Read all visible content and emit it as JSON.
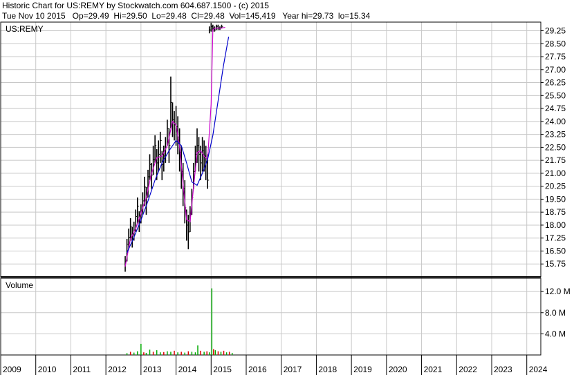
{
  "header": {
    "title": "Historic Chart for US:REMY by Stockwatch.com 604.687.1500 - (c) 2015",
    "info": "Tue Nov 10 2015   Op=29.49  Hi=29.50  Lo=29.48  Cl=29.48  Vol=145,419   Year hi=29.73  lo=15.34"
  },
  "colors": {
    "grid": "#c8c8c8",
    "price": "#000000",
    "ma_short": "#cc00cc",
    "ma_long": "#0000cc",
    "vol_up": "#00aa00",
    "vol_down": "#dd0000"
  },
  "chart_data": {
    "type": "line",
    "price_panel": {
      "label": "US:REMY",
      "ylim": [
        15.0,
        29.75
      ],
      "yticks": [
        "15.75",
        "16.50",
        "17.25",
        "18.00",
        "18.75",
        "19.50",
        "20.25",
        "21.00",
        "21.75",
        "22.50",
        "23.25",
        "24.00",
        "24.75",
        "25.50",
        "26.25",
        "27.00",
        "27.75",
        "28.50",
        "29.25"
      ],
      "xlim": [
        2009.0,
        2024.4
      ],
      "series": [
        {
          "role": "price",
          "x": [
            2012.55,
            2012.6,
            2012.65,
            2012.7,
            2012.75,
            2012.8,
            2012.85,
            2012.9,
            2012.95,
            2013.0,
            2013.05,
            2013.1,
            2013.15,
            2013.2,
            2013.25,
            2013.3,
            2013.35,
            2013.4,
            2013.45,
            2013.5,
            2013.55,
            2013.6,
            2013.65,
            2013.7,
            2013.75,
            2013.8,
            2013.85,
            2013.9,
            2013.95,
            2014.0,
            2014.05,
            2014.1,
            2014.15,
            2014.2,
            2014.25,
            2014.3,
            2014.35,
            2014.4,
            2014.45,
            2014.5,
            2014.55,
            2014.6,
            2014.65,
            2014.7,
            2014.75,
            2014.8,
            2014.85,
            2014.9,
            2014.95,
            2015.0,
            2015.05,
            2015.1,
            2015.15,
            2015.2,
            2015.25,
            2015.3,
            2015.35,
            2015.4,
            2015.45,
            2015.5,
            2015.55,
            2015.6,
            2015.65,
            2015.7,
            2015.75,
            2015.8,
            2015.85
          ],
          "high": [
            16.2,
            17.2,
            17.8,
            18.4,
            17.9,
            18.2,
            18.9,
            19.6,
            18.8,
            19.2,
            19.9,
            20.8,
            20.2,
            21.2,
            22.1,
            21.6,
            22.6,
            23.2,
            22.4,
            22.9,
            23.4,
            22.3,
            22.6,
            23.1,
            24.1,
            23.6,
            26.6,
            25.1,
            24.6,
            24.9,
            24.3,
            23.6,
            22.6,
            21.6,
            20.6,
            18.9,
            18.6,
            19.1,
            20.1,
            21.6,
            22.6,
            23.6,
            23.1,
            22.6,
            23.1,
            22.9,
            22.6,
            22.1,
            29.5,
            29.7,
            29.6,
            29.5,
            29.6,
            29.6,
            29.5,
            29.6
          ],
          "low": [
            15.3,
            15.9,
            16.6,
            17.1,
            16.7,
            17.1,
            17.6,
            18.1,
            17.6,
            18.1,
            18.6,
            19.1,
            18.6,
            19.6,
            20.6,
            20.1,
            20.9,
            21.6,
            20.6,
            21.1,
            21.6,
            20.6,
            21.1,
            21.6,
            22.6,
            21.6,
            23.6,
            23.1,
            22.9,
            22.6,
            22.1,
            21.1,
            20.1,
            19.1,
            18.1,
            17.1,
            16.6,
            17.6,
            18.6,
            20.1,
            21.1,
            21.6,
            21.1,
            20.6,
            21.1,
            21.1,
            20.6,
            20.1,
            29.1,
            29.2,
            29.2,
            29.2,
            29.3,
            29.3,
            29.3,
            29.4
          ],
          "close": [
            15.9,
            16.9,
            17.3,
            17.9,
            17.2,
            17.7,
            18.5,
            19.1,
            18.2,
            18.8,
            19.4,
            20.2,
            19.6,
            20.8,
            21.5,
            20.9,
            21.8,
            22.6,
            21.6,
            22.1,
            22.9,
            21.5,
            22.0,
            22.5,
            23.6,
            22.6,
            25.1,
            24.1,
            23.8,
            23.7,
            23.1,
            22.2,
            21.1,
            20.1,
            19.0,
            18.0,
            17.6,
            18.6,
            19.6,
            21.1,
            22.1,
            22.6,
            22.1,
            21.6,
            22.3,
            22.0,
            21.6,
            20.6,
            29.3,
            29.5,
            29.4,
            29.3,
            29.5,
            29.4,
            29.4,
            29.48
          ]
        },
        {
          "role": "moving-average-short",
          "x": [
            2012.55,
            2012.7,
            2012.85,
            2013.0,
            2013.15,
            2013.3,
            2013.45,
            2013.6,
            2013.75,
            2013.9,
            2014.0,
            2014.1,
            2014.2,
            2014.3,
            2014.4,
            2014.5,
            2014.6,
            2014.7,
            2014.8,
            2014.9,
            2015.0,
            2015.05,
            2015.1,
            2015.2,
            2015.3,
            2015.4
          ],
          "values": [
            15.6,
            17.2,
            17.8,
            18.7,
            19.6,
            21.0,
            21.9,
            22.0,
            22.6,
            24.0,
            23.8,
            22.6,
            20.4,
            18.3,
            18.2,
            20.2,
            22.2,
            22.3,
            22.0,
            21.8,
            25.0,
            29.3,
            29.4,
            29.4,
            29.4,
            29.45
          ]
        },
        {
          "role": "moving-average-long",
          "x": [
            2012.6,
            2012.8,
            2013.0,
            2013.2,
            2013.4,
            2013.6,
            2013.8,
            2014.0,
            2014.15,
            2014.3,
            2014.45,
            2014.6,
            2014.75,
            2014.9,
            2015.05,
            2015.2,
            2015.35,
            2015.5
          ],
          "values": [
            16.4,
            17.3,
            18.3,
            19.4,
            20.6,
            21.6,
            22.3,
            22.9,
            22.6,
            21.6,
            20.5,
            20.3,
            21.0,
            21.8,
            23.2,
            25.2,
            27.2,
            28.9
          ]
        }
      ]
    },
    "volume_panel": {
      "label": "Volume",
      "ylim": [
        0,
        14.5
      ],
      "yticks": [
        "4.0 M",
        "8.0 M",
        "12.0 M"
      ],
      "bars": [
        {
          "x": 2012.6,
          "v": 0.35,
          "dir": "up"
        },
        {
          "x": 2012.7,
          "v": 0.6,
          "dir": "down"
        },
        {
          "x": 2012.8,
          "v": 0.45,
          "dir": "up"
        },
        {
          "x": 2012.9,
          "v": 0.7,
          "dir": "up"
        },
        {
          "x": 2013.0,
          "v": 2.1,
          "dir": "up"
        },
        {
          "x": 2013.08,
          "v": 0.5,
          "dir": "down"
        },
        {
          "x": 2013.15,
          "v": 0.4,
          "dir": "up"
        },
        {
          "x": 2013.25,
          "v": 1.0,
          "dir": "up"
        },
        {
          "x": 2013.35,
          "v": 0.6,
          "dir": "down"
        },
        {
          "x": 2013.45,
          "v": 0.9,
          "dir": "up"
        },
        {
          "x": 2013.55,
          "v": 0.5,
          "dir": "up"
        },
        {
          "x": 2013.65,
          "v": 0.55,
          "dir": "down"
        },
        {
          "x": 2013.75,
          "v": 0.7,
          "dir": "up"
        },
        {
          "x": 2013.85,
          "v": 0.6,
          "dir": "up"
        },
        {
          "x": 2013.95,
          "v": 0.8,
          "dir": "down"
        },
        {
          "x": 2014.05,
          "v": 0.5,
          "dir": "up"
        },
        {
          "x": 2014.15,
          "v": 0.6,
          "dir": "down"
        },
        {
          "x": 2014.25,
          "v": 0.45,
          "dir": "up"
        },
        {
          "x": 2014.35,
          "v": 0.7,
          "dir": "down"
        },
        {
          "x": 2014.45,
          "v": 0.6,
          "dir": "up"
        },
        {
          "x": 2014.55,
          "v": 0.5,
          "dir": "up"
        },
        {
          "x": 2014.62,
          "v": 1.8,
          "dir": "up"
        },
        {
          "x": 2014.7,
          "v": 0.8,
          "dir": "down"
        },
        {
          "x": 2014.8,
          "v": 0.6,
          "dir": "up"
        },
        {
          "x": 2014.88,
          "v": 0.7,
          "dir": "down"
        },
        {
          "x": 2014.95,
          "v": 0.5,
          "dir": "up"
        },
        {
          "x": 2015.02,
          "v": 12.6,
          "dir": "up"
        },
        {
          "x": 2015.07,
          "v": 1.1,
          "dir": "down"
        },
        {
          "x": 2015.12,
          "v": 0.9,
          "dir": "up"
        },
        {
          "x": 2015.2,
          "v": 0.7,
          "dir": "down"
        },
        {
          "x": 2015.28,
          "v": 0.6,
          "dir": "up"
        },
        {
          "x": 2015.36,
          "v": 0.8,
          "dir": "down"
        },
        {
          "x": 2015.44,
          "v": 0.5,
          "dir": "up"
        },
        {
          "x": 2015.52,
          "v": 0.6,
          "dir": "down"
        },
        {
          "x": 2015.6,
          "v": 0.4,
          "dir": "up"
        }
      ]
    },
    "x_axis": {
      "categories": [
        "2009",
        "2010",
        "2011",
        "2012",
        "2013",
        "2014",
        "2015",
        "2016",
        "2017",
        "2018",
        "2019",
        "2020",
        "2021",
        "2022",
        "2023",
        "2024"
      ]
    },
    "grid": true
  }
}
